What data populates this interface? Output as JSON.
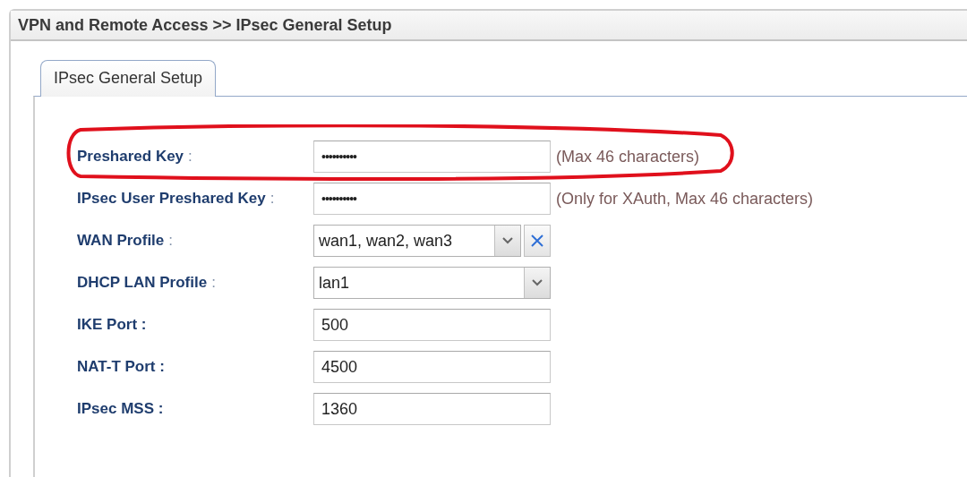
{
  "window": {
    "title": "VPN and Remote Access >> IPsec General Setup"
  },
  "tabs": [
    {
      "label": "IPsec General Setup",
      "selected": true
    }
  ],
  "rows": [
    {
      "kind": "password",
      "label": "Preshared Key",
      "separator": ":",
      "value": "••••••••••",
      "hint": "(Max 46 characters)",
      "highlighted": true
    },
    {
      "kind": "password",
      "label": "IPsec User Preshared Key",
      "separator": ":",
      "value": "••••••••••",
      "hint": "(Only for XAuth, Max 46 characters)",
      "highlighted": false
    },
    {
      "kind": "select",
      "label": "WAN Profile",
      "separator": ":",
      "value": "wan1, wan2, wan3",
      "clearable": true,
      "highlighted": false
    },
    {
      "kind": "select",
      "label": "DHCP LAN Profile",
      "separator": ":",
      "value": "lan1",
      "clearable": false,
      "highlighted": false
    },
    {
      "kind": "text",
      "label": "IKE Port :",
      "value": "500",
      "highlighted": false
    },
    {
      "kind": "text",
      "label": "NAT-T Port :",
      "value": "4500",
      "highlighted": false
    },
    {
      "kind": "text",
      "label": "IPsec MSS :",
      "value": "1360",
      "highlighted": false
    }
  ]
}
